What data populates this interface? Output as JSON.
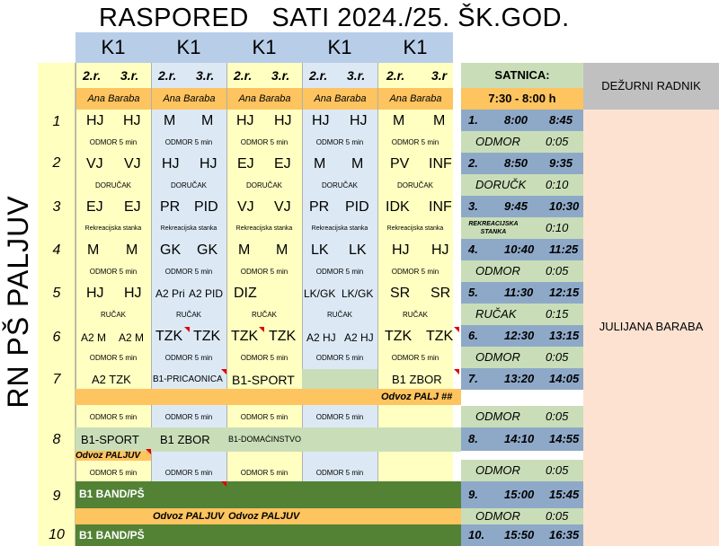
{
  "title": "RASPORED   SATI 2024./25. ŠK.GOD.",
  "classes": [
    "K1",
    "K1",
    "K1",
    "K1",
    "K1"
  ],
  "grades": {
    "a": "2.r.",
    "b": "3.r.",
    "b_last": "3.r"
  },
  "teacher": "Ana Baraba",
  "school": "RN PŠ PALJUV",
  "satnica": {
    "header": "SATNICA:",
    "time": "7:30 - 8:00 h"
  },
  "duty": {
    "header": "DEŽURNI RADNIK",
    "name": "JULIJANA BARABA"
  },
  "rows": [
    "1",
    "2",
    "3",
    "4",
    "5",
    "6",
    "7",
    "8",
    "9",
    "10"
  ],
  "cells": {
    "r1": [
      [
        "HJ",
        "HJ"
      ],
      [
        "M",
        "M"
      ],
      [
        "HJ",
        "HJ"
      ],
      [
        "HJ",
        "HJ"
      ],
      [
        "M",
        "M"
      ]
    ],
    "r2": [
      [
        "VJ",
        "VJ"
      ],
      [
        "HJ",
        "HJ"
      ],
      [
        "EJ",
        "EJ"
      ],
      [
        "M",
        "M"
      ],
      [
        "PV",
        "INF"
      ]
    ],
    "r3": [
      [
        "EJ",
        "EJ"
      ],
      [
        "PR",
        "PID"
      ],
      [
        "VJ",
        "VJ"
      ],
      [
        "PR",
        "PID"
      ],
      [
        "IDK",
        "INF"
      ]
    ],
    "r4": [
      [
        "M",
        "M"
      ],
      [
        "GK",
        "GK"
      ],
      [
        "M",
        "M"
      ],
      [
        "LK",
        "LK"
      ],
      [
        "HJ",
        "HJ"
      ]
    ],
    "r5": [
      [
        "HJ",
        "HJ"
      ],
      [
        "A2 Pri",
        "A2 PID"
      ],
      [
        "DIZ",
        ""
      ],
      [
        "LK/GK",
        "LK/GK"
      ],
      [
        "SR",
        "SR"
      ]
    ],
    "r6": [
      [
        "A2 M",
        "A2 M"
      ],
      [
        "TZK",
        "TZK"
      ],
      [
        "TZK",
        "TZK"
      ],
      [
        "A2 HJ",
        "A2 HJ"
      ],
      [
        "TZK",
        "TZK"
      ]
    ],
    "r7": [
      "A2 TZK",
      "B1-PRIČAONICA",
      "B1-SPORT",
      "",
      "B1 ZBOR"
    ],
    "r8": [
      "B1-SPORT",
      "B1 ZBOR",
      "B1-DOMAĆINSTVO",
      "",
      ""
    ],
    "r9": "B1 BAND/PŠ",
    "r10": "B1 BAND/PŠ"
  },
  "breaks": {
    "odmor": "ODMOR 5 min",
    "dorucak": "DORUČAK",
    "rekreacijska": "Rekreacijska stanka",
    "rucak": "RUČAK"
  },
  "transport": {
    "palj": "Odvoz PALJ ##",
    "paljuv": "Odvoz PALJUV"
  },
  "schedule": [
    {
      "n": "1.",
      "start": "8:00",
      "end": "8:45"
    },
    {
      "label": "ODMOR",
      "dur": "0:05"
    },
    {
      "n": "2.",
      "start": "8:50",
      "end": "9:35"
    },
    {
      "label": "DORUČK",
      "dur": "0:10"
    },
    {
      "n": "3.",
      "start": "9:45",
      "end": "10:30"
    },
    {
      "label": "REKREACIJSKA STANKA",
      "dur": "0:10"
    },
    {
      "n": "4.",
      "start": "10:40",
      "end": "11:25"
    },
    {
      "label": "ODMOR",
      "dur": "0:05"
    },
    {
      "n": "5.",
      "start": "11:30",
      "end": "12:15"
    },
    {
      "label": "RUČAK",
      "dur": "0:15"
    },
    {
      "n": "6.",
      "start": "12:30",
      "end": "13:15"
    },
    {
      "label": "ODMOR",
      "dur": "0:05"
    },
    {
      "n": "7.",
      "start": "13:20",
      "end": "14:05"
    },
    {
      "label": "ODMOR",
      "dur": "0:05"
    },
    {
      "n": "8.",
      "start": "14:10",
      "end": "14:55"
    },
    {
      "label": "ODMOR",
      "dur": "0:05"
    },
    {
      "n": "9.",
      "start": "15:00",
      "end": "15:45"
    },
    {
      "label": "ODMOR",
      "dur": "0:05"
    },
    {
      "n": "10.",
      "start": "15:50",
      "end": "16:35"
    }
  ]
}
